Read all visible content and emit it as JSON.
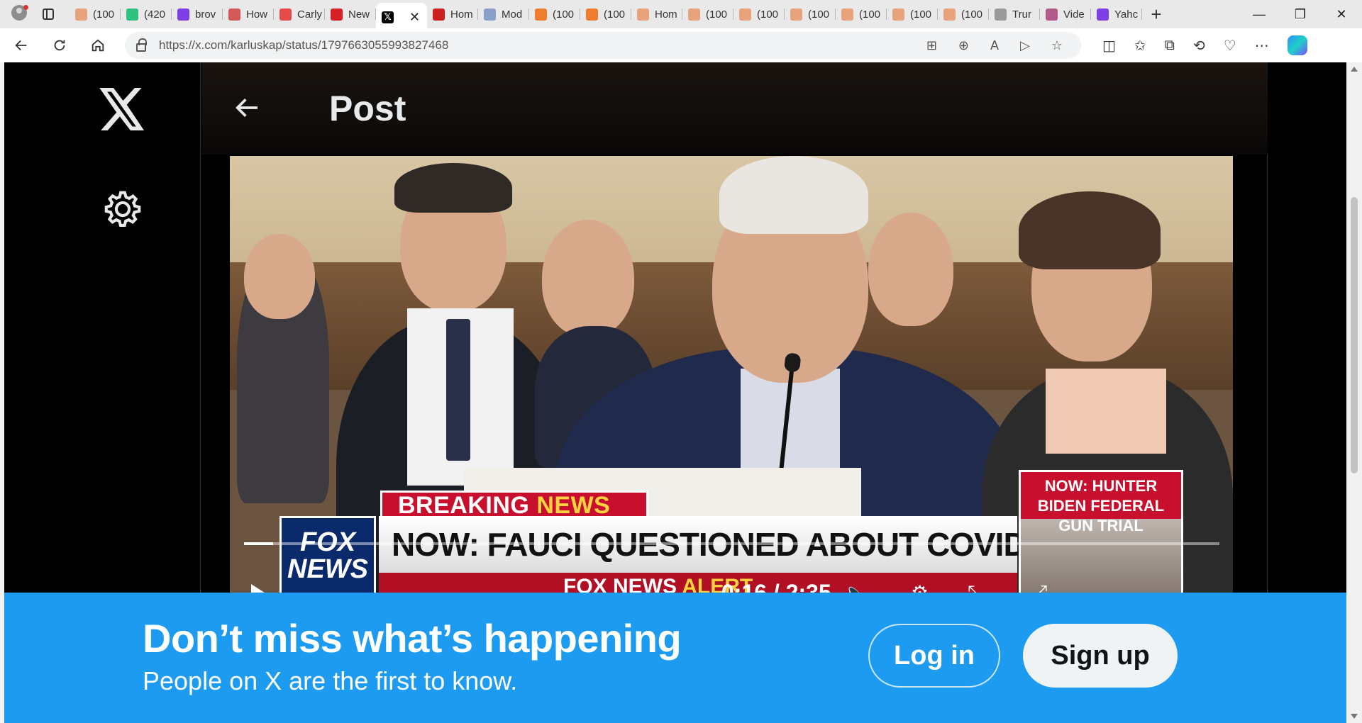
{
  "browser": {
    "tabs": [
      {
        "label": "(100",
        "favicon": "bookmark-icon",
        "color": "#e8a27c"
      },
      {
        "label": "(420",
        "favicon": "g-icon",
        "color": "#2ec27e"
      },
      {
        "label": "brov",
        "favicon": "yahoo-icon",
        "color": "#7b3fe4"
      },
      {
        "label": "How",
        "favicon": "bi-icon",
        "color": "#d45a5a"
      },
      {
        "label": "Carly",
        "favicon": "youtube-icon",
        "color": "#e54b4b"
      },
      {
        "label": "New",
        "favicon": "r-icon",
        "color": "#d61f26"
      },
      {
        "label": "",
        "favicon": "x-icon",
        "color": "#000000",
        "active": true
      },
      {
        "label": "Hom",
        "favicon": "stop-icon",
        "color": "#cc1f1f"
      },
      {
        "label": "Mod",
        "favicon": "ai-icon",
        "color": "#8aa0c8"
      },
      {
        "label": "(100",
        "favicon": "bookmark-icon",
        "color": "#f07d2e"
      },
      {
        "label": "(100",
        "favicon": "bookmark-icon",
        "color": "#f07d2e"
      },
      {
        "label": "Hom",
        "favicon": "bookmark-icon",
        "color": "#e8a27c"
      },
      {
        "label": "(100",
        "favicon": "bookmark-icon",
        "color": "#e8a27c"
      },
      {
        "label": "(100",
        "favicon": "bookmark-icon",
        "color": "#e8a27c"
      },
      {
        "label": "(100",
        "favicon": "bookmark-icon",
        "color": "#e8a27c"
      },
      {
        "label": "(100",
        "favicon": "bookmark-icon",
        "color": "#e8a27c"
      },
      {
        "label": "(100",
        "favicon": "bookmark-icon",
        "color": "#e8a27c"
      },
      {
        "label": "(100",
        "favicon": "bookmark-icon",
        "color": "#e8a27c"
      },
      {
        "label": "Trur",
        "favicon": "page-icon",
        "color": "#9a9a9a"
      },
      {
        "label": "Vide",
        "favicon": "star-icon",
        "color": "#b35a8c"
      },
      {
        "label": "Yahc",
        "favicon": "yahoo-icon",
        "color": "#7b3fe4"
      }
    ],
    "new_tab": "+",
    "close_tab": "✕",
    "url": "https://x.com/karluskap/status/1797663055993827468",
    "window": {
      "minimize": "—",
      "restore": "❐",
      "close": "✕"
    }
  },
  "sidebar": {
    "logo": "x-logo-icon",
    "settings": "gear-icon"
  },
  "header": {
    "title": "Post",
    "back": "back-arrow-icon"
  },
  "video": {
    "breaking": "BREAKING",
    "breaking_news": "NEWS",
    "headline": "NOW: FAUCI QUESTIONED ABOUT COVID EMAILS",
    "fox_line1": "FOX",
    "fox_line2": "NEWS",
    "ticker_left": "FOX NEWS",
    "ticker_alert": "ALERT",
    "side_header": "NOW: HUNTER BIDEN FEDERAL GUN TRIAL",
    "time": "0:16 / 2:35",
    "progress": 0.03
  },
  "banner": {
    "title": "Don’t miss what’s happening",
    "subtitle": "People on X are the first to know.",
    "login": "Log in",
    "signup": "Sign up"
  },
  "colors": {
    "accent": "#1d9bf0",
    "breaking_red": "#c8102e",
    "fox_blue": "#0b2a6b"
  }
}
